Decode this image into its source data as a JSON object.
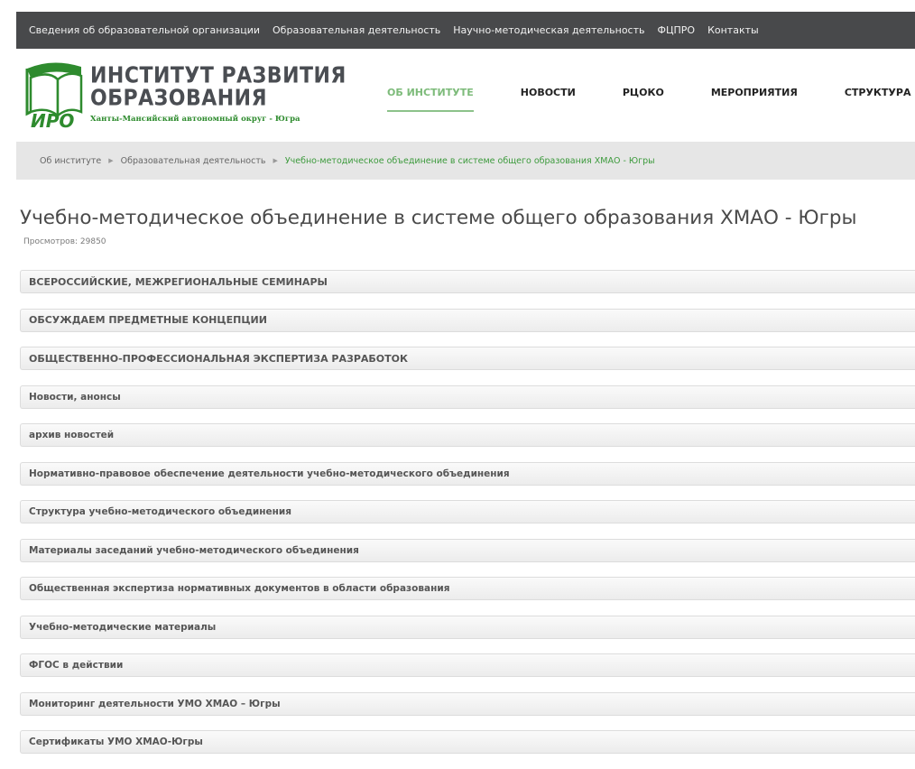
{
  "topnav": {
    "items": [
      "Сведения об образовательной организации",
      "Образовательная деятельность",
      "Научно-методическая деятельность",
      "ФЦПРО",
      "Контакты"
    ]
  },
  "logo": {
    "line1": "ИНСТИТУТ РАЗВИТИЯ",
    "line2": "ОБРАЗОВАНИЯ",
    "subtitle": "Ханты-Мансийский автономный округ - Югра",
    "abbr": "ИРО"
  },
  "mainnav": {
    "items": [
      "ОБ ИНСТИТУТЕ",
      "НОВОСТИ",
      "РЦОКО",
      "МЕРОПРИЯТИЯ",
      "СТРУКТУРА"
    ],
    "active_index": 0
  },
  "breadcrumb": {
    "items": [
      "Об институте",
      "Образовательная деятельность",
      "Учебно-методическое объединение в системе общего образования ХМАО - Югры"
    ]
  },
  "page": {
    "title": "Учебно-методическое объединение в системе общего образования ХМАО - Югры",
    "views_label": "Просмотров:",
    "views_count": "29850"
  },
  "accordion": {
    "items": [
      "ВСЕРОССИЙСКИЕ, МЕЖРЕГИОНАЛЬНЫЕ СЕМИНАРЫ",
      "ОБСУЖДАЕМ ПРЕДМЕТНЫЕ КОНЦЕПЦИИ",
      "ОБЩЕСТВЕННО-ПРОФЕССИОНАЛЬНАЯ ЭКСПЕРТИЗА  РАЗРАБОТОК",
      "Новости, анонсы",
      "архив новостей",
      "Нормативно-правовое обеспечение деятельности учебно-методического объединения",
      "Структура учебно-методического объединения",
      "Материалы заседаний учебно-методического объединения",
      "Общественная экспертиза нормативных документов в области образования",
      "Учебно-методические материалы",
      "ФГОС в действии",
      "Мониторинг деятельности УМО  ХМАО – Югры",
      "Сертификаты УМО ХМАО-Югры"
    ]
  },
  "colors": {
    "topbar_bg": "#48494b",
    "accent_green": "#3c9a3c",
    "active_nav": "#7dbb7a",
    "breadcrumb_bg": "#e6e6e6"
  }
}
